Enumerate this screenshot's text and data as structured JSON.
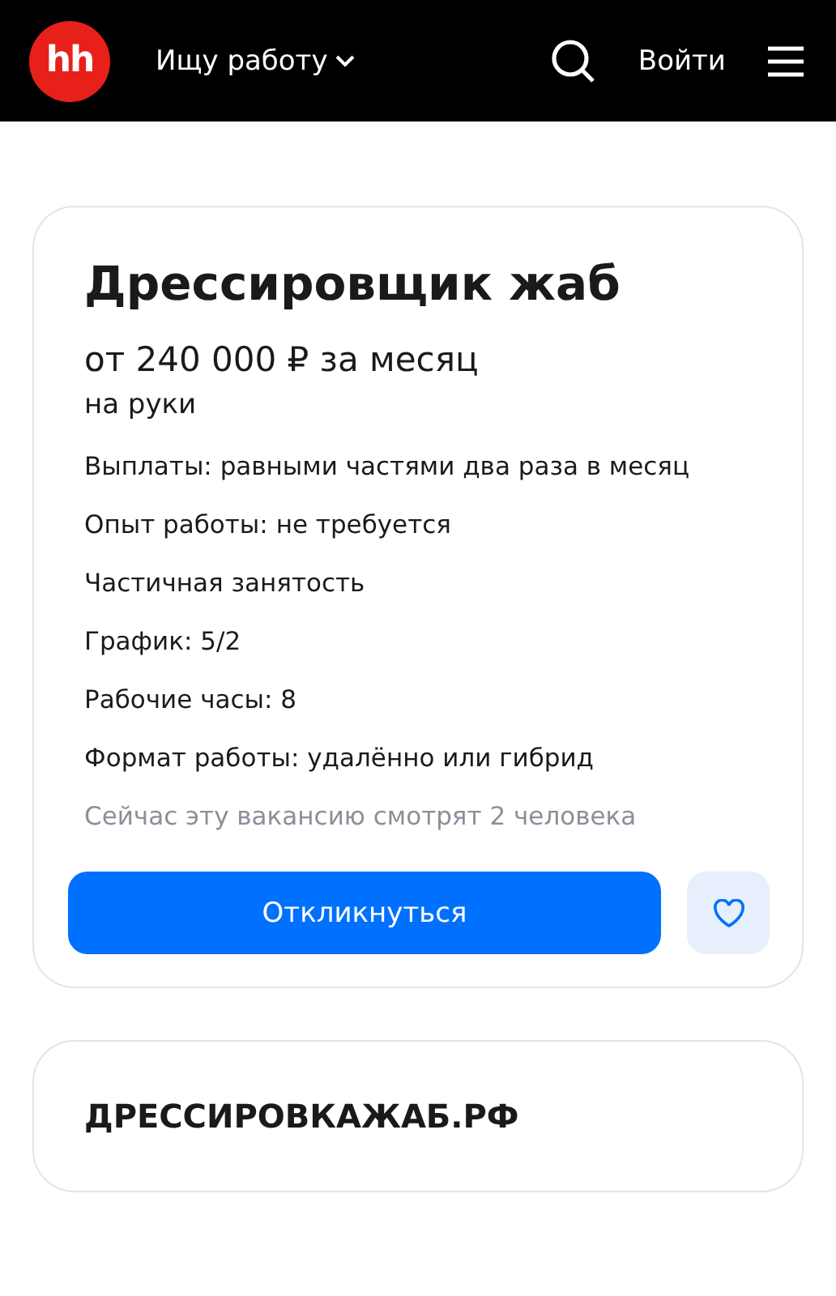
{
  "header": {
    "logo": "hh",
    "menu_label": "Ищу работу",
    "login": "Войти"
  },
  "vacancy": {
    "title": "Дрессировщик жаб",
    "salary": "от 240 000 ₽ за месяц",
    "salary_note": "на руки",
    "details": [
      "Выплаты: равными частями два раза в месяц",
      "Опыт работы: не требуется",
      "Частичная занятость",
      "График: 5/2",
      "Рабочие часы: 8",
      "Формат работы: удалённо или гибрид"
    ],
    "viewers": "Сейчас эту вакансию смотрят 2 человека",
    "apply_button": "Откликнуться",
    "favorite": false
  },
  "employer": {
    "name": "ДРЕССИРОВКАЖАБ.РФ"
  }
}
